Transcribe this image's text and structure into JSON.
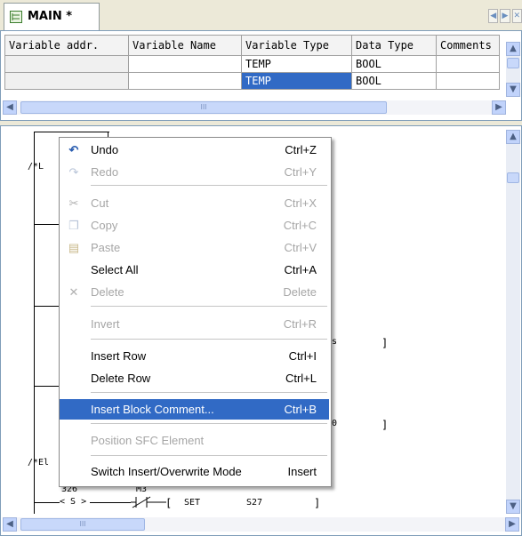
{
  "tab": {
    "label": "MAIN *"
  },
  "variables": {
    "headers": [
      "Variable addr.",
      "Variable Name",
      "Variable Type",
      "Data Type",
      "Comments"
    ],
    "rows": [
      {
        "addr": "",
        "name": "",
        "type": "TEMP",
        "dtype": "BOOL",
        "comments": ""
      },
      {
        "addr": "",
        "name": "",
        "type": "TEMP",
        "dtype": "BOOL",
        "comments": ""
      }
    ],
    "hscroll_grip": "III"
  },
  "ladder": {
    "label1": "/*L",
    "label2": "/*El",
    "addr1": "326",
    "contact_label": "M3",
    "coil_left": "< S >",
    "func_label": "SET",
    "func_arg": "S27",
    "bracket": "]",
    "frag_s": "s",
    "frag_0": "0",
    "hscroll_grip": "III"
  },
  "context_menu": {
    "items": [
      {
        "icon": "undo-icon",
        "label": "Undo",
        "shortcut": "Ctrl+Z",
        "disabled": false
      },
      {
        "icon": "redo-icon",
        "label": "Redo",
        "shortcut": "Ctrl+Y",
        "disabled": true
      },
      {
        "icon": "cut-icon",
        "label": "Cut",
        "shortcut": "Ctrl+X",
        "disabled": true
      },
      {
        "icon": "copy-icon",
        "label": "Copy",
        "shortcut": "Ctrl+C",
        "disabled": true
      },
      {
        "icon": "paste-icon",
        "label": "Paste",
        "shortcut": "Ctrl+V",
        "disabled": true
      },
      {
        "icon": "",
        "label": "Select All",
        "shortcut": "Ctrl+A",
        "disabled": false
      },
      {
        "icon": "delete-icon",
        "label": "Delete",
        "shortcut": "Delete",
        "disabled": true
      },
      {
        "icon": "",
        "label": "Invert",
        "shortcut": "Ctrl+R",
        "disabled": true
      },
      {
        "icon": "",
        "label": "Insert Row",
        "shortcut": "Ctrl+I",
        "disabled": false
      },
      {
        "icon": "",
        "label": "Delete Row",
        "shortcut": "Ctrl+L",
        "disabled": false
      },
      {
        "icon": "",
        "label": "Insert Block Comment...",
        "shortcut": "Ctrl+B",
        "disabled": false,
        "highlighted": true
      },
      {
        "icon": "",
        "label": "Position SFC Element",
        "shortcut": "",
        "disabled": true
      },
      {
        "icon": "",
        "label": "Switch Insert/Overwrite Mode",
        "shortcut": "Insert",
        "disabled": false
      }
    ]
  },
  "colors": {
    "highlight": "#316ac5",
    "disabled_text": "#a6a6a6",
    "tab_bg": "#ece9d8"
  }
}
